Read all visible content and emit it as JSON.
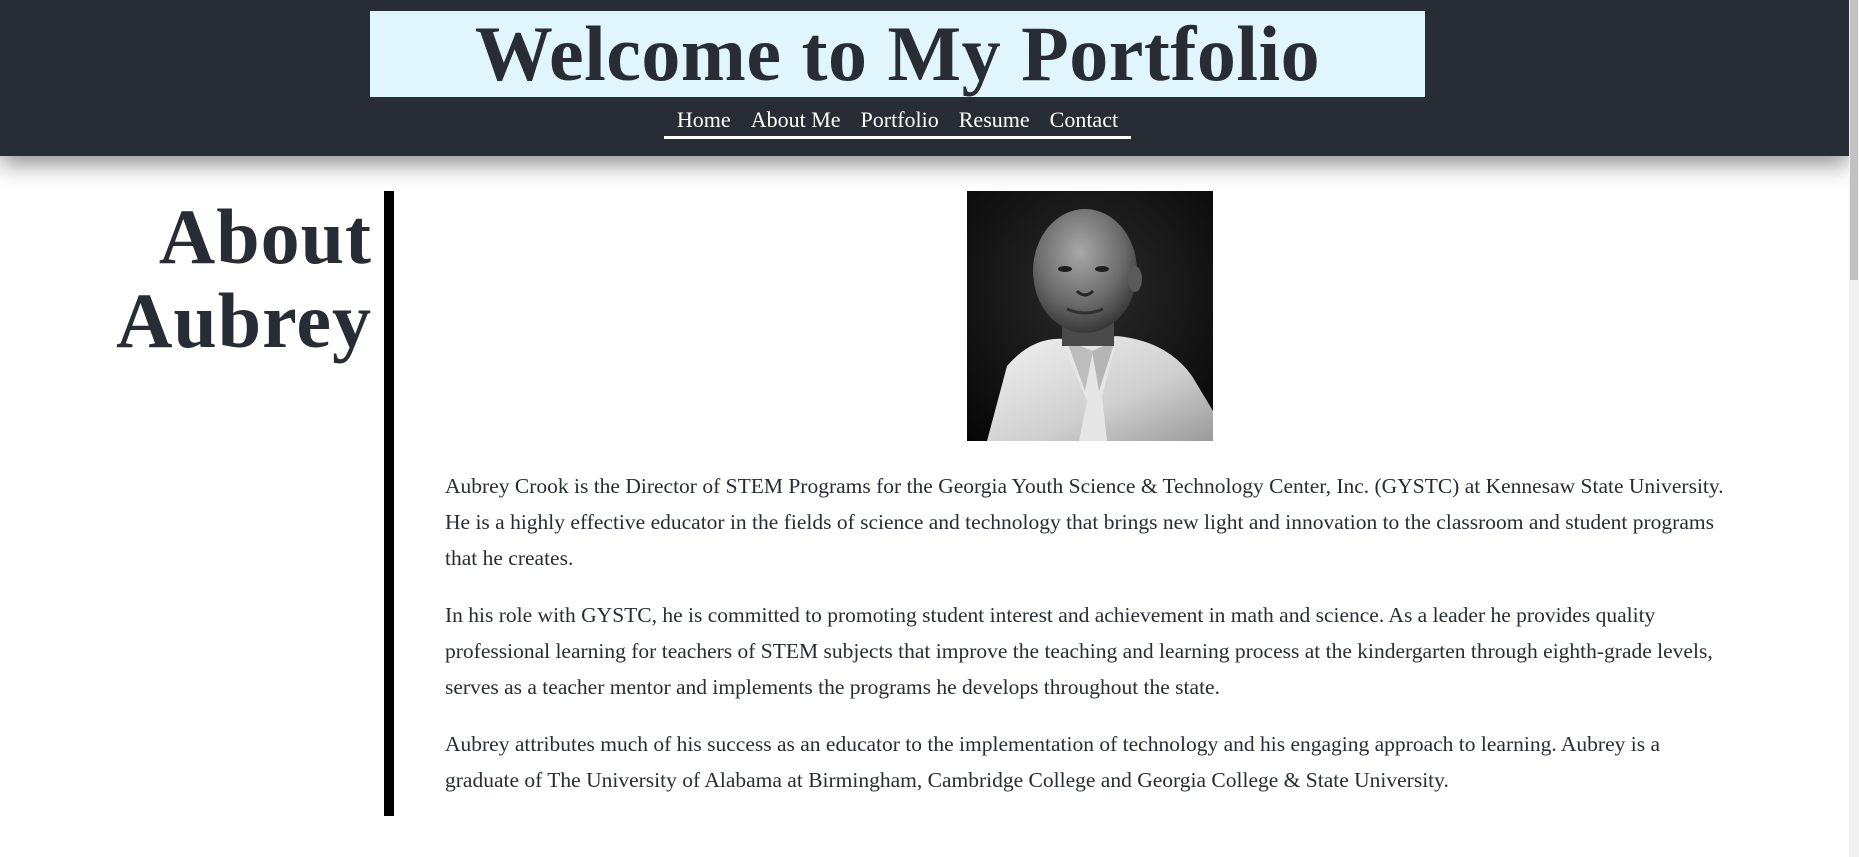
{
  "header": {
    "title": "Welcome to My Portfolio",
    "nav": [
      {
        "label": "Home"
      },
      {
        "label": "About Me"
      },
      {
        "label": "Portfolio"
      },
      {
        "label": "Resume"
      },
      {
        "label": "Contact"
      }
    ]
  },
  "about": {
    "heading": "About Aubrey",
    "portrait_icon": "portrait-photo",
    "paragraphs": [
      "Aubrey Crook is the Director of STEM Programs for the Georgia Youth Science & Technology Center, Inc. (GYSTC) at Kennesaw State University. He is a highly effective educator in the fields of science and technology that brings new light and innovation to the classroom and student programs that he creates.",
      "In his role with GYSTC, he is committed to promoting student interest and achievement in math and science. As a leader he provides quality professional learning for teachers of STEM subjects that improve the teaching and learning process at the kindergarten through eighth-grade levels, serves as a teacher mentor and implements the programs he develops throughout the state.",
      "Aubrey attributes much of his success as an educator to the implementation of technology and his engaging approach to learning. Aubrey is a graduate of The University of Alabama at Birmingham, Cambridge College and Georgia College & State University."
    ]
  },
  "colors": {
    "header_bg": "#282c34",
    "title_box_bg": "#e0f5fc",
    "text": "#282c34",
    "divider": "#000000"
  }
}
